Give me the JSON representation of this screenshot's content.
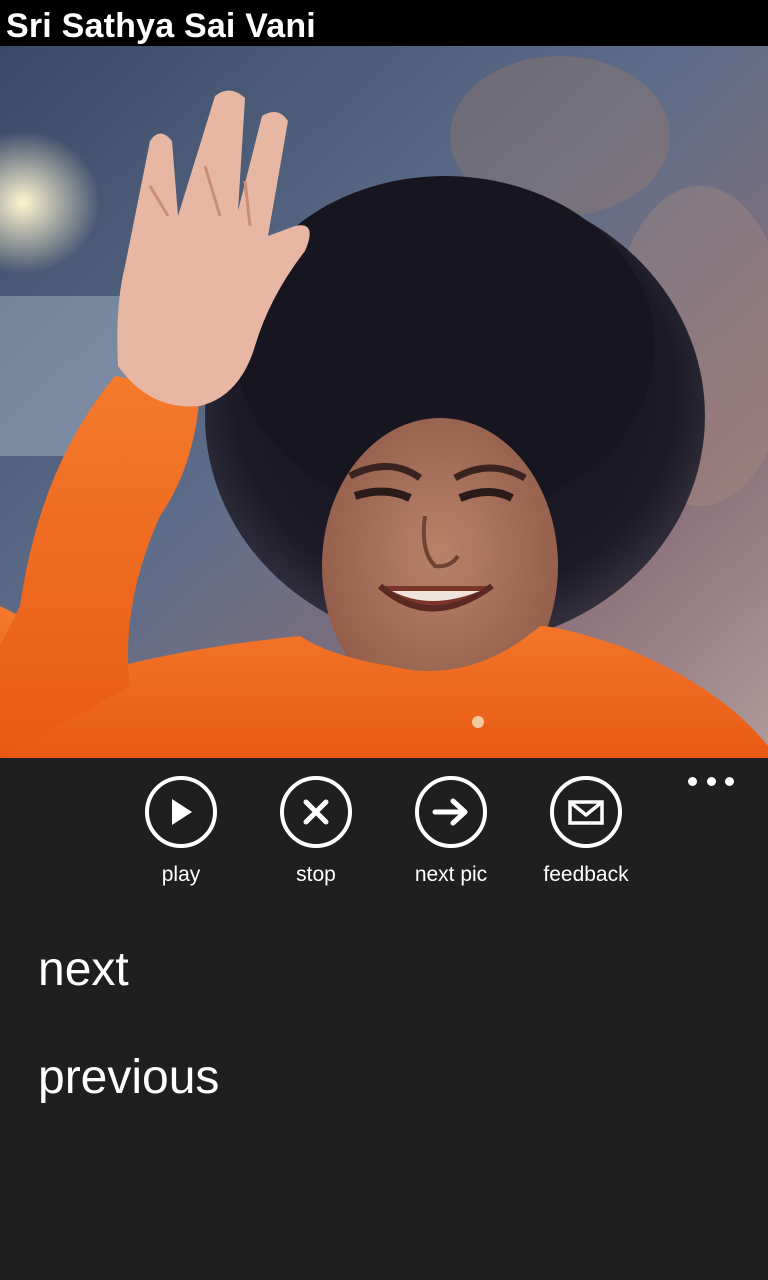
{
  "header": {
    "title": "Sri Sathya Sai Vani"
  },
  "app_bar": {
    "buttons": [
      {
        "label": "play",
        "icon": "play-icon"
      },
      {
        "label": "stop",
        "icon": "close-icon"
      },
      {
        "label": "next pic",
        "icon": "arrow-right-icon"
      },
      {
        "label": "feedback",
        "icon": "mail-icon"
      }
    ],
    "more_icon": "ellipsis-icon"
  },
  "menu": {
    "items": [
      {
        "label": "next"
      },
      {
        "label": "previous"
      }
    ]
  },
  "colors": {
    "title_bar": "#000000",
    "app_bar": "#1f1f1f",
    "robe": "#f26a21",
    "text": "#ffffff"
  }
}
